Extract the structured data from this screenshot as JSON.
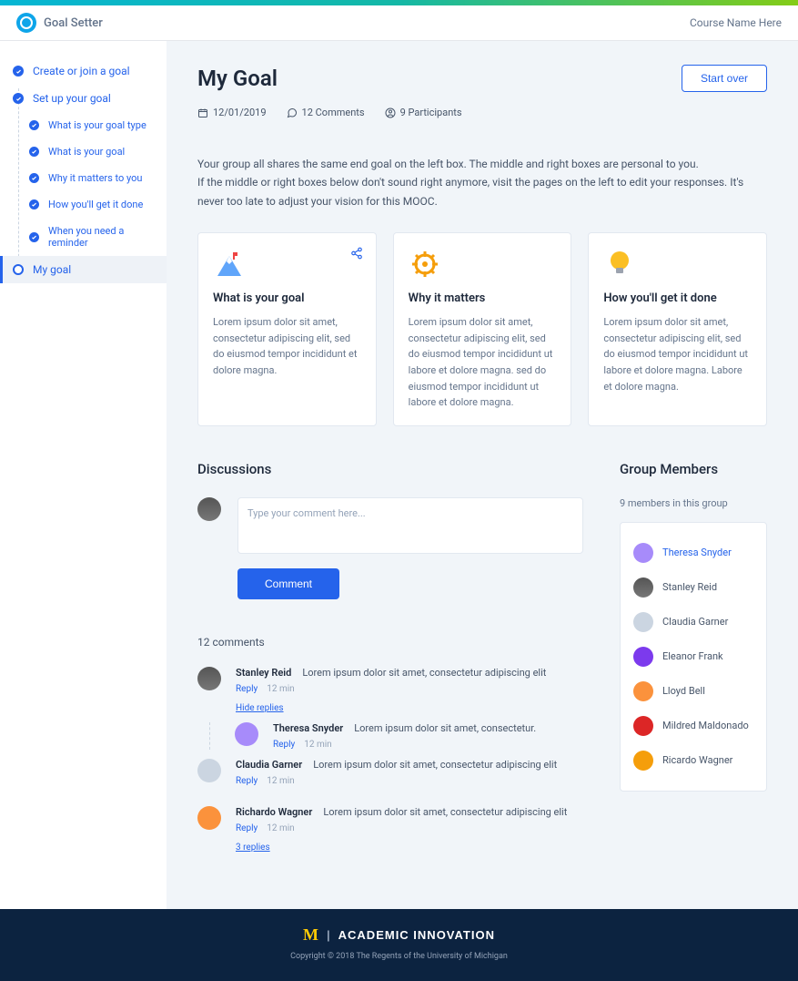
{
  "header": {
    "brand": "Goal Setter",
    "course": "Course Name Here"
  },
  "sidebar": {
    "items": [
      {
        "label": "Create or join a goal",
        "done": true
      },
      {
        "label": "Set up your goal",
        "done": true
      }
    ],
    "sub": [
      {
        "label": "What is your goal type"
      },
      {
        "label": "What is your goal"
      },
      {
        "label": "Why it matters to you"
      },
      {
        "label": "How you'll get it done"
      },
      {
        "label": "When you need a reminder"
      }
    ],
    "current": "My goal"
  },
  "page": {
    "title": "My Goal",
    "start_over": "Start over",
    "date": "12/01/2019",
    "comments_meta": "12 Comments",
    "participants_meta": "9 Participants",
    "intro1": "Your group all shares the same end goal on the left box. The middle and right boxes are personal to you.",
    "intro2": "If the middle or right boxes below don't sound right anymore, visit the pages on the left to edit your responses. It's never too late to adjust your vision for this MOOC."
  },
  "cards": [
    {
      "title": "What is your goal",
      "body": "Lorem ipsum dolor sit amet, consectetur adipiscing elit, sed do eiusmod tempor incididunt et dolore magna."
    },
    {
      "title": "Why it matters",
      "body": "Lorem ipsum dolor sit amet, consectetur adipiscing elit, sed do eiusmod tempor incididunt ut labore et dolore magna. sed do eiusmod tempor incididunt ut labore et dolore magna."
    },
    {
      "title": "How you'll get it done",
      "body": "Lorem ipsum dolor sit amet, consectetur adipiscing elit, sed do eiusmod tempor incididunt ut labore et dolore magna. Labore et dolore magna."
    }
  ],
  "discussions": {
    "title": "Discussions",
    "placeholder": "Type your comment here...",
    "submit": "Comment",
    "count_label": "12 comments",
    "reply_label": "Reply",
    "hide_replies": "Hide replies",
    "three_replies": "3 replies",
    "comments": [
      {
        "author": "Stanley Reid",
        "text": "Lorem ipsum dolor sit amet, consectetur adipiscing elit",
        "time": "12 min",
        "toggle": "hide",
        "replies": [
          {
            "author": "Theresa Snyder",
            "text": "Lorem ipsum dolor sit amet, consectetur.",
            "time": "12 min"
          }
        ]
      },
      {
        "author": "Claudia Garner",
        "text": "Lorem ipsum dolor sit amet, consectetur adipiscing elit",
        "time": "12 min"
      },
      {
        "author": "Richardo Wagner",
        "text": "Lorem ipsum dolor sit amet, consectetur adipiscing elit",
        "time": "12 min",
        "toggle": "three"
      }
    ]
  },
  "members": {
    "title": "Group Members",
    "subtitle": "9 members in this group",
    "list": [
      "Theresa Snyder",
      "Stanley Reid",
      "Claudia Garner",
      "Eleanor Frank",
      "Lloyd Bell",
      "Mildred Maldonado",
      "Ricardo Wagner"
    ]
  },
  "footer": {
    "brand": "ACADEMIC INNOVATION",
    "copy": "Copyright  ©  2018     The Regents of the University of Michigan"
  },
  "colors": {
    "accent": "#2563eb"
  },
  "avatar_bgs": [
    "#6b7280",
    "#a78bfa",
    "#f59e0b",
    "#fb923c",
    "#84cc16",
    "#0ea5e9",
    "#94a3b8"
  ]
}
